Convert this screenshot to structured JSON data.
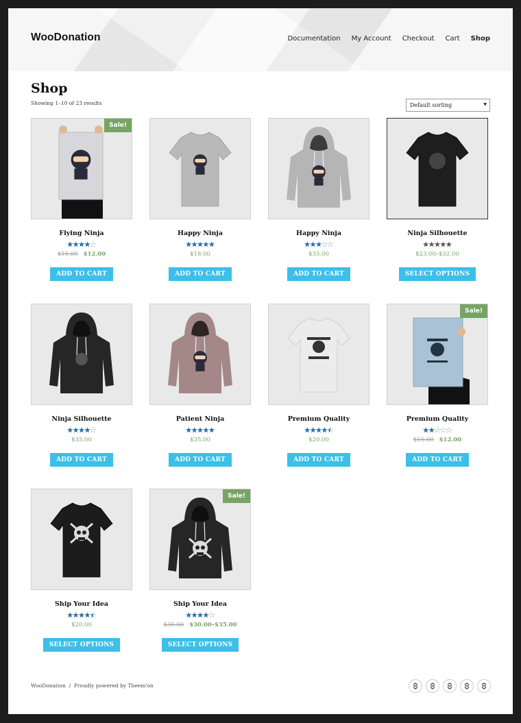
{
  "header": {
    "site_title": "WooDonation",
    "nav": [
      "Documentation",
      "My Account",
      "Checkout",
      "Cart",
      "Shop"
    ],
    "active": "Shop"
  },
  "page": {
    "title": "Shop",
    "result_count": "Showing 1–10 of 23 results",
    "sort_label": "Default sorting"
  },
  "colors": {
    "accent": "#3cbfe8",
    "sale": "#77a464",
    "star": "#1f6fb5"
  },
  "products": [
    {
      "name": "Flying Ninja",
      "rating": 4,
      "old_price": "$15.00",
      "price": "$12.00",
      "sale": "Sale!",
      "button": "ADD TO CART",
      "image": "poster-ninja"
    },
    {
      "name": "Happy Ninja",
      "rating": 5,
      "old_price": "",
      "price": "$18.00",
      "sale": "",
      "button": "ADD TO CART",
      "image": "tshirt-grey"
    },
    {
      "name": "Happy Ninja",
      "rating": 3,
      "old_price": "",
      "price": "$35.00",
      "sale": "",
      "button": "ADD TO CART",
      "image": "hoodie-grey"
    },
    {
      "name": "Ninja Silhouette",
      "rating": 5,
      "old_price": "",
      "price": "$23.00–$32.00",
      "sale": "",
      "button": "SELECT OPTIONS",
      "image": "tshirt-black"
    },
    {
      "name": "Ninja Silhouette",
      "rating": 4,
      "old_price": "",
      "price": "$35.00",
      "sale": "",
      "button": "ADD TO CART",
      "image": "hoodie-black"
    },
    {
      "name": "Patient Ninja",
      "rating": 5,
      "old_price": "",
      "price": "$35.00",
      "sale": "",
      "button": "ADD TO CART",
      "image": "hoodie-pink"
    },
    {
      "name": "Premium Quality",
      "rating": 4.5,
      "old_price": "",
      "price": "$20.00",
      "sale": "",
      "button": "ADD TO CART",
      "image": "tshirt-white"
    },
    {
      "name": "Premium Quality",
      "rating": 2,
      "old_price": "$15.00",
      "price": "$12.00",
      "sale": "Sale!",
      "button": "ADD TO CART",
      "image": "poster-woo"
    },
    {
      "name": "Ship Your Idea",
      "rating": 4.5,
      "old_price": "",
      "price": "$20.00",
      "sale": "",
      "button": "SELECT OPTIONS",
      "image": "tshirt-skull"
    },
    {
      "name": "Ship Your Idea",
      "rating": 4,
      "old_price": "$35.00",
      "price": "$30.00–$35.00",
      "sale": "Sale!",
      "button": "SELECT OPTIONS",
      "image": "hoodie-skull"
    }
  ],
  "footer": {
    "site": "WooDonation",
    "separator": "/",
    "credit": "Proudly powered by Theem'on",
    "icons": [
      "theemon-icon",
      "theemon-icon",
      "theemon-icon",
      "theemon-icon",
      "theemon-icon"
    ]
  }
}
